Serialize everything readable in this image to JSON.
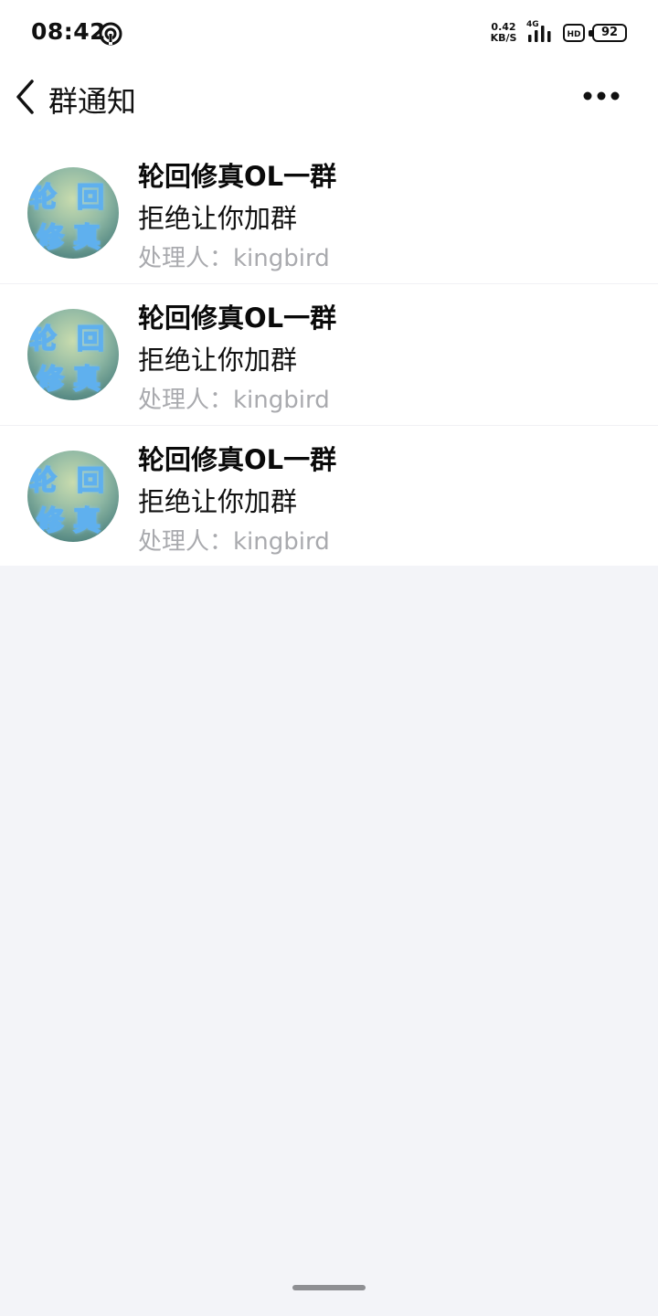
{
  "status_bar": {
    "time": "08:42",
    "net_speed_value": "0.42",
    "net_speed_unit": "KB/S",
    "network_type": "4G",
    "hd_label": "HD",
    "battery": "92"
  },
  "header": {
    "title": "群通知"
  },
  "notifications": [
    {
      "avatar_chars": [
        "轮",
        "回",
        "修",
        "真"
      ],
      "group_name": "轮回修真OL一群",
      "status": "拒绝让你加群",
      "handler": "处理人：kingbird"
    },
    {
      "avatar_chars": [
        "轮",
        "回",
        "修",
        "真"
      ],
      "group_name": "轮回修真OL一群",
      "status": "拒绝让你加群",
      "handler": "处理人：kingbird"
    },
    {
      "avatar_chars": [
        "轮",
        "回",
        "修",
        "真"
      ],
      "group_name": "轮回修真OL一群",
      "status": "拒绝让你加群",
      "handler": "处理人：kingbird"
    }
  ],
  "colors": {
    "background": "#f3f4f8",
    "surface": "#ffffff",
    "secondary_text": "#a9aaae",
    "primary_text": "#111111"
  }
}
